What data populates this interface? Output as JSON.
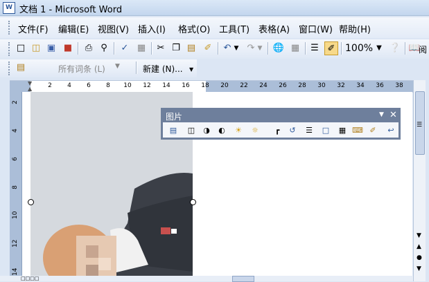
{
  "window": {
    "title": "文档 1 - Microsoft Word",
    "app_icon": "W"
  },
  "menubar": {
    "items": [
      "文件(F)",
      "编辑(E)",
      "视图(V)",
      "插入(I)",
      "格式(O)",
      "工具(T)",
      "表格(A)",
      "窗口(W)",
      "帮助(H)"
    ]
  },
  "toolbar": {
    "zoom": "100%",
    "read_label": "阅"
  },
  "toolbar2": {
    "style_value": "所有词条 (L)",
    "new_label": "新建 (N)..."
  },
  "ruler": {
    "h_ticks": [
      "2",
      "4",
      "6",
      "8",
      "10",
      "12",
      "14",
      "16",
      "18",
      "20",
      "22",
      "24",
      "26",
      "28",
      "30",
      "32",
      "34",
      "36",
      "38"
    ],
    "v_ticks": [
      "2",
      "4",
      "6",
      "8",
      "10",
      "12",
      "14"
    ]
  },
  "picture_toolbar": {
    "title": "图片"
  },
  "colors": {
    "accent": "#2b579a",
    "toolbar_title": "#6e7f9c"
  }
}
